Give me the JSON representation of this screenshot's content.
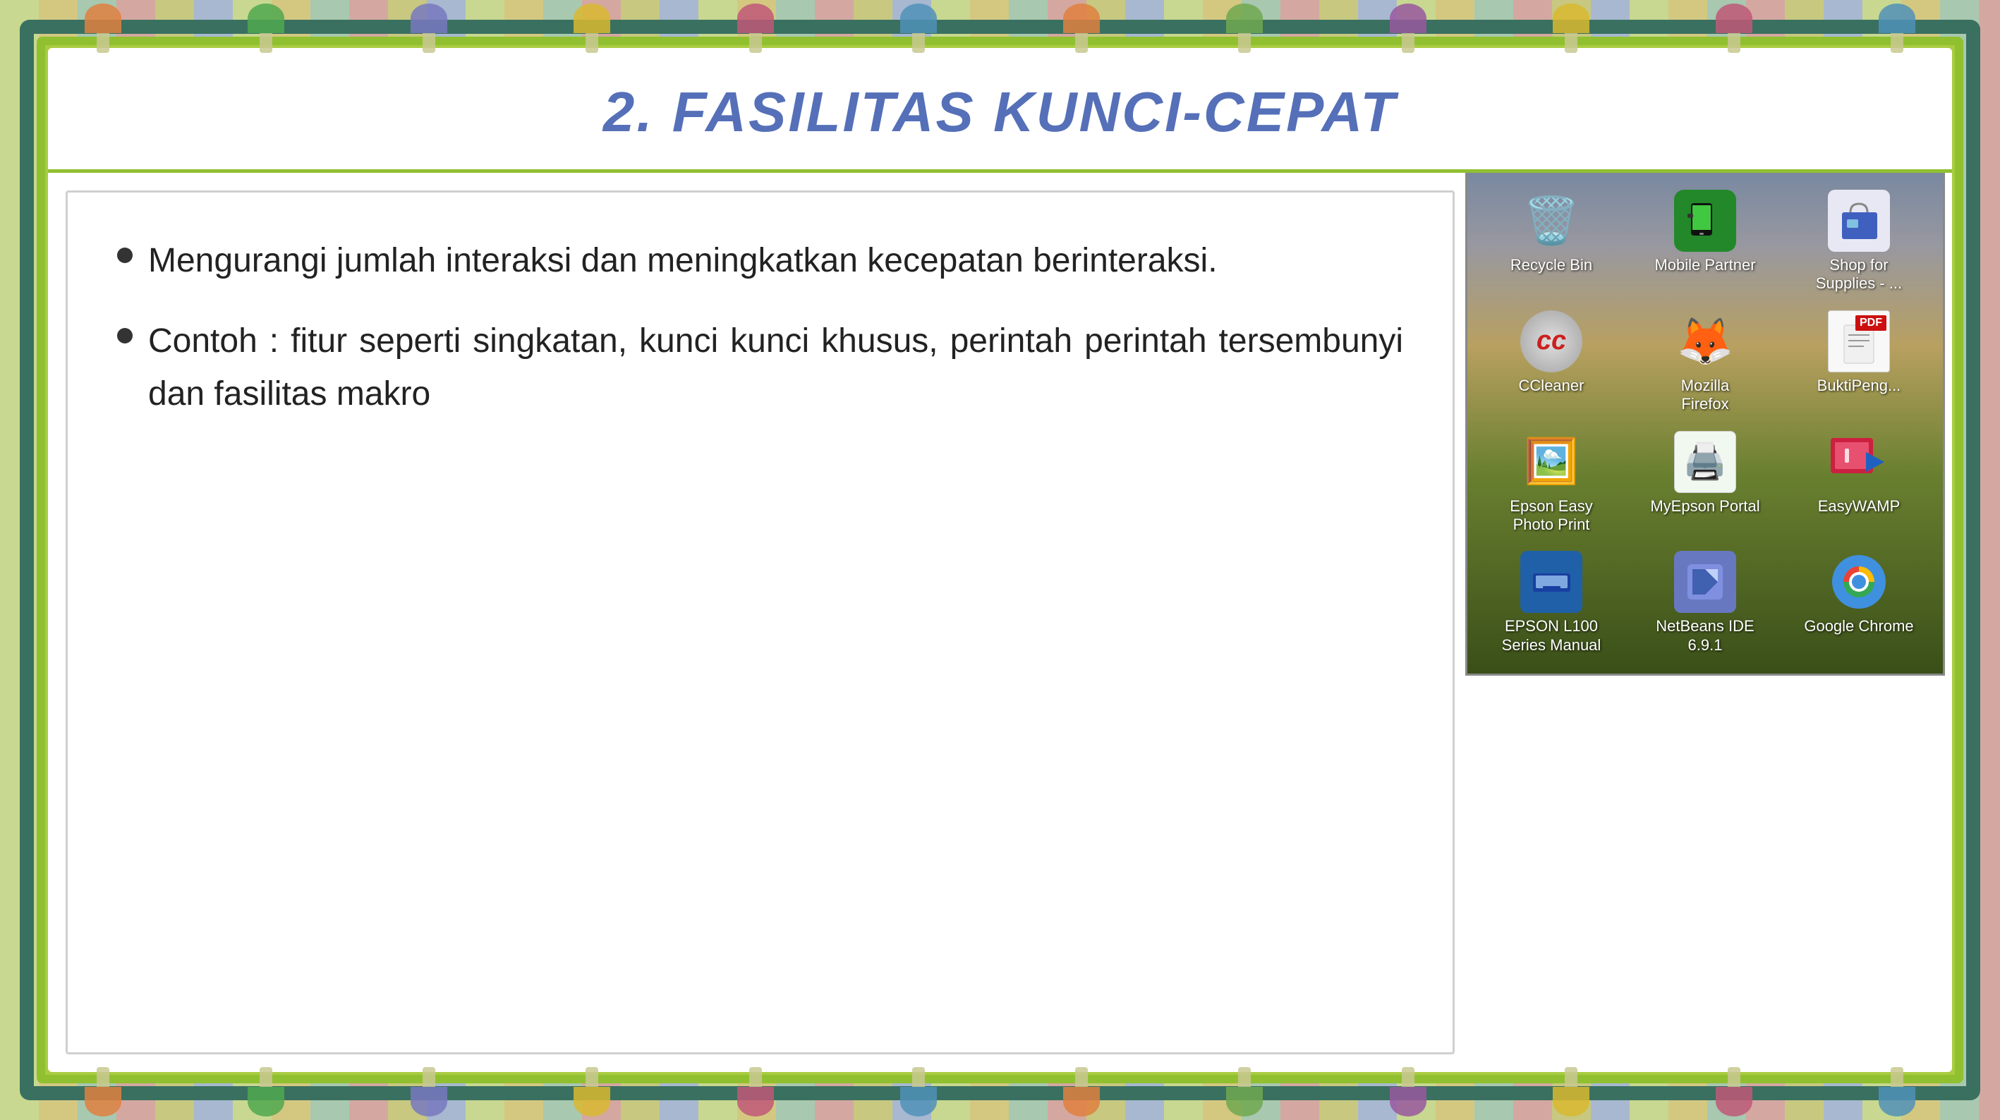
{
  "background": {
    "colors": [
      "#c8d880",
      "#b8d060",
      "#90b840"
    ]
  },
  "slide": {
    "title": "2. FASILITAS KUNCI-CEPAT",
    "bullets": [
      {
        "id": 1,
        "text": "Mengurangi jumlah interaksi dan meningkatkan kecepatan berinteraksi."
      },
      {
        "id": 2,
        "text": "Contoh : fitur seperti singkatan, kunci kunci khusus, perintah perintah tersembunyi dan fasilitas makro"
      }
    ]
  },
  "desktop_icons": [
    {
      "id": "recycle-bin",
      "label": "Recycle Bin",
      "icon_type": "recycle",
      "color": "#808080"
    },
    {
      "id": "mobile-partner",
      "label": "Mobile Partner",
      "icon_type": "mobile",
      "color": "#2a8a2a"
    },
    {
      "id": "shop-for-supplies",
      "label": "Shop for Supplies - ...",
      "icon_type": "shop",
      "color": "#4060c0"
    },
    {
      "id": "ccleaner",
      "label": "CCleaner",
      "icon_type": "ccleaner",
      "color": "#c0c0c0"
    },
    {
      "id": "mozilla-firefox",
      "label": "Mozilla Firefox",
      "icon_type": "firefox",
      "color": "#e05010"
    },
    {
      "id": "bukti-peng",
      "label": "BuktiPeng...",
      "icon_type": "pdf",
      "color": "#cc2020"
    },
    {
      "id": "epson-easy-photo-print",
      "label": "Epson Easy Photo Print",
      "icon_type": "epson-easy",
      "color": "#3060a0"
    },
    {
      "id": "myepson-portal",
      "label": "MyEpson Portal",
      "icon_type": "myepson",
      "color": "#40a040"
    },
    {
      "id": "easywamp",
      "label": "EasyWAMP",
      "icon_type": "easywamp",
      "color": "#cc2040"
    },
    {
      "id": "epson-l100",
      "label": "EPSON L100 Series Manual",
      "icon_type": "epson-l100",
      "color": "#2060aa"
    },
    {
      "id": "netbeans",
      "label": "NetBeans IDE 6.9.1",
      "icon_type": "netbeans",
      "color": "#6080c0"
    },
    {
      "id": "google-chrome",
      "label": "Google Chrome",
      "icon_type": "chrome",
      "color": "#4090e0"
    }
  ],
  "deco_shapes": [
    {
      "color": "#e08040",
      "stem": "#d0d0b0"
    },
    {
      "color": "#60b060",
      "stem": "#d0d0b0"
    },
    {
      "color": "#8080c0",
      "stem": "#d0d0b0"
    },
    {
      "color": "#e0c040",
      "stem": "#d0d0b0"
    },
    {
      "color": "#c06080",
      "stem": "#d0d0b0"
    },
    {
      "color": "#60a0c0",
      "stem": "#d0d0b0"
    },
    {
      "color": "#e08040",
      "stem": "#d0d0b0"
    },
    {
      "color": "#80b060",
      "stem": "#d0d0b0"
    },
    {
      "color": "#a060a0",
      "stem": "#d0d0b0"
    },
    {
      "color": "#e0c040",
      "stem": "#d0d0b0"
    },
    {
      "color": "#c06080",
      "stem": "#d0d0b0"
    },
    {
      "color": "#60a0c0",
      "stem": "#d0d0b0"
    },
    {
      "color": "#e08040",
      "stem": "#d0d0b0"
    },
    {
      "color": "#60b060",
      "stem": "#d0d0b0"
    },
    {
      "color": "#8080c0",
      "stem": "#d0d0b0"
    },
    {
      "color": "#e0c040",
      "stem": "#d0d0b0"
    },
    {
      "color": "#c06080",
      "stem": "#d0d0b0"
    },
    {
      "color": "#60a0c0",
      "stem": "#d0d0b0"
    }
  ]
}
